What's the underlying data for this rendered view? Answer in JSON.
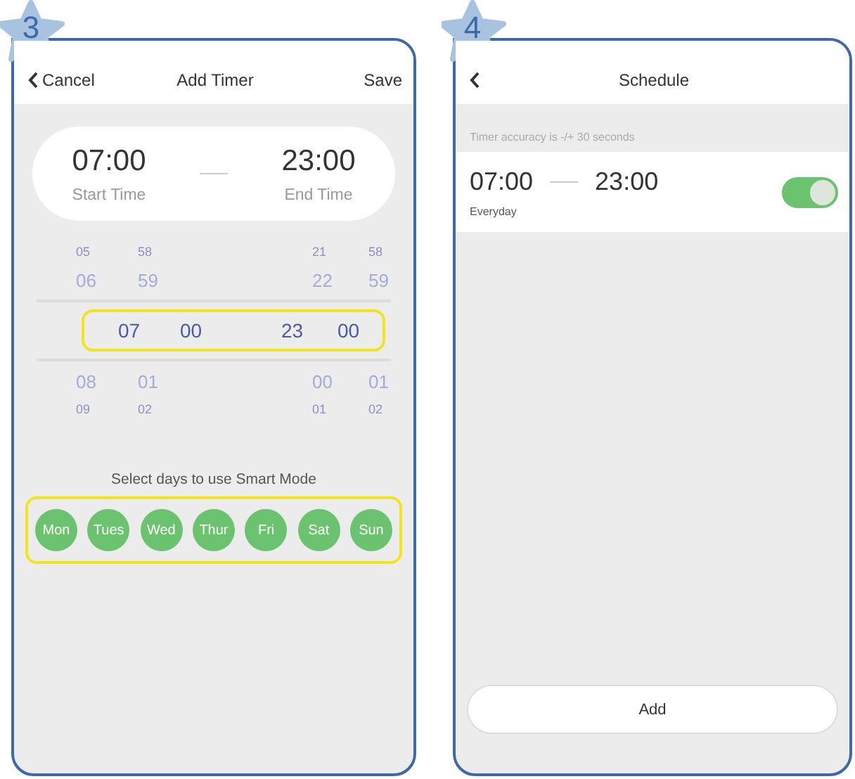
{
  "screens": [
    {
      "step": "3",
      "kind": "add_timer",
      "header": {
        "back": "Cancel",
        "title": "Add Timer",
        "action": "Save"
      },
      "times": {
        "start": "07:00",
        "start_label": "Start Time",
        "end": "23:00",
        "end_label": "End Time"
      },
      "picker": {
        "highlighted": true,
        "rows": [
          {
            "kind": "edge",
            "selected": false,
            "cells": [
              "05",
              "58",
              "21",
              "58"
            ]
          },
          {
            "kind": "near",
            "selected": false,
            "cells": [
              "06",
              "59",
              "22",
              "59"
            ]
          },
          {
            "kind": "near",
            "selected": true,
            "cells": [
              "07",
              "00",
              "23",
              "00"
            ]
          },
          {
            "kind": "near",
            "selected": false,
            "cells": [
              "08",
              "01",
              "00",
              "01"
            ]
          },
          {
            "kind": "edge",
            "selected": false,
            "cells": [
              "09",
              "02",
              "01",
              "02"
            ]
          }
        ]
      },
      "days_prompt": "Select days to use Smart Mode",
      "days_highlighted": true,
      "days": [
        {
          "label": "Mon",
          "selected": true
        },
        {
          "label": "Tues",
          "selected": true
        },
        {
          "label": "Wed",
          "selected": true
        },
        {
          "label": "Thur",
          "selected": true
        },
        {
          "label": "Fri",
          "selected": true
        },
        {
          "label": "Sat",
          "selected": true
        },
        {
          "label": "Sun",
          "selected": true
        }
      ]
    },
    {
      "step": "4",
      "kind": "schedule",
      "header": {
        "title": "Schedule"
      },
      "note": "Timer accuracy is -/+ 30 seconds",
      "timers": [
        {
          "start": "07:00",
          "end": "23:00",
          "repeat": "Everyday",
          "on": true
        }
      ],
      "add_button": "Add"
    }
  ]
}
